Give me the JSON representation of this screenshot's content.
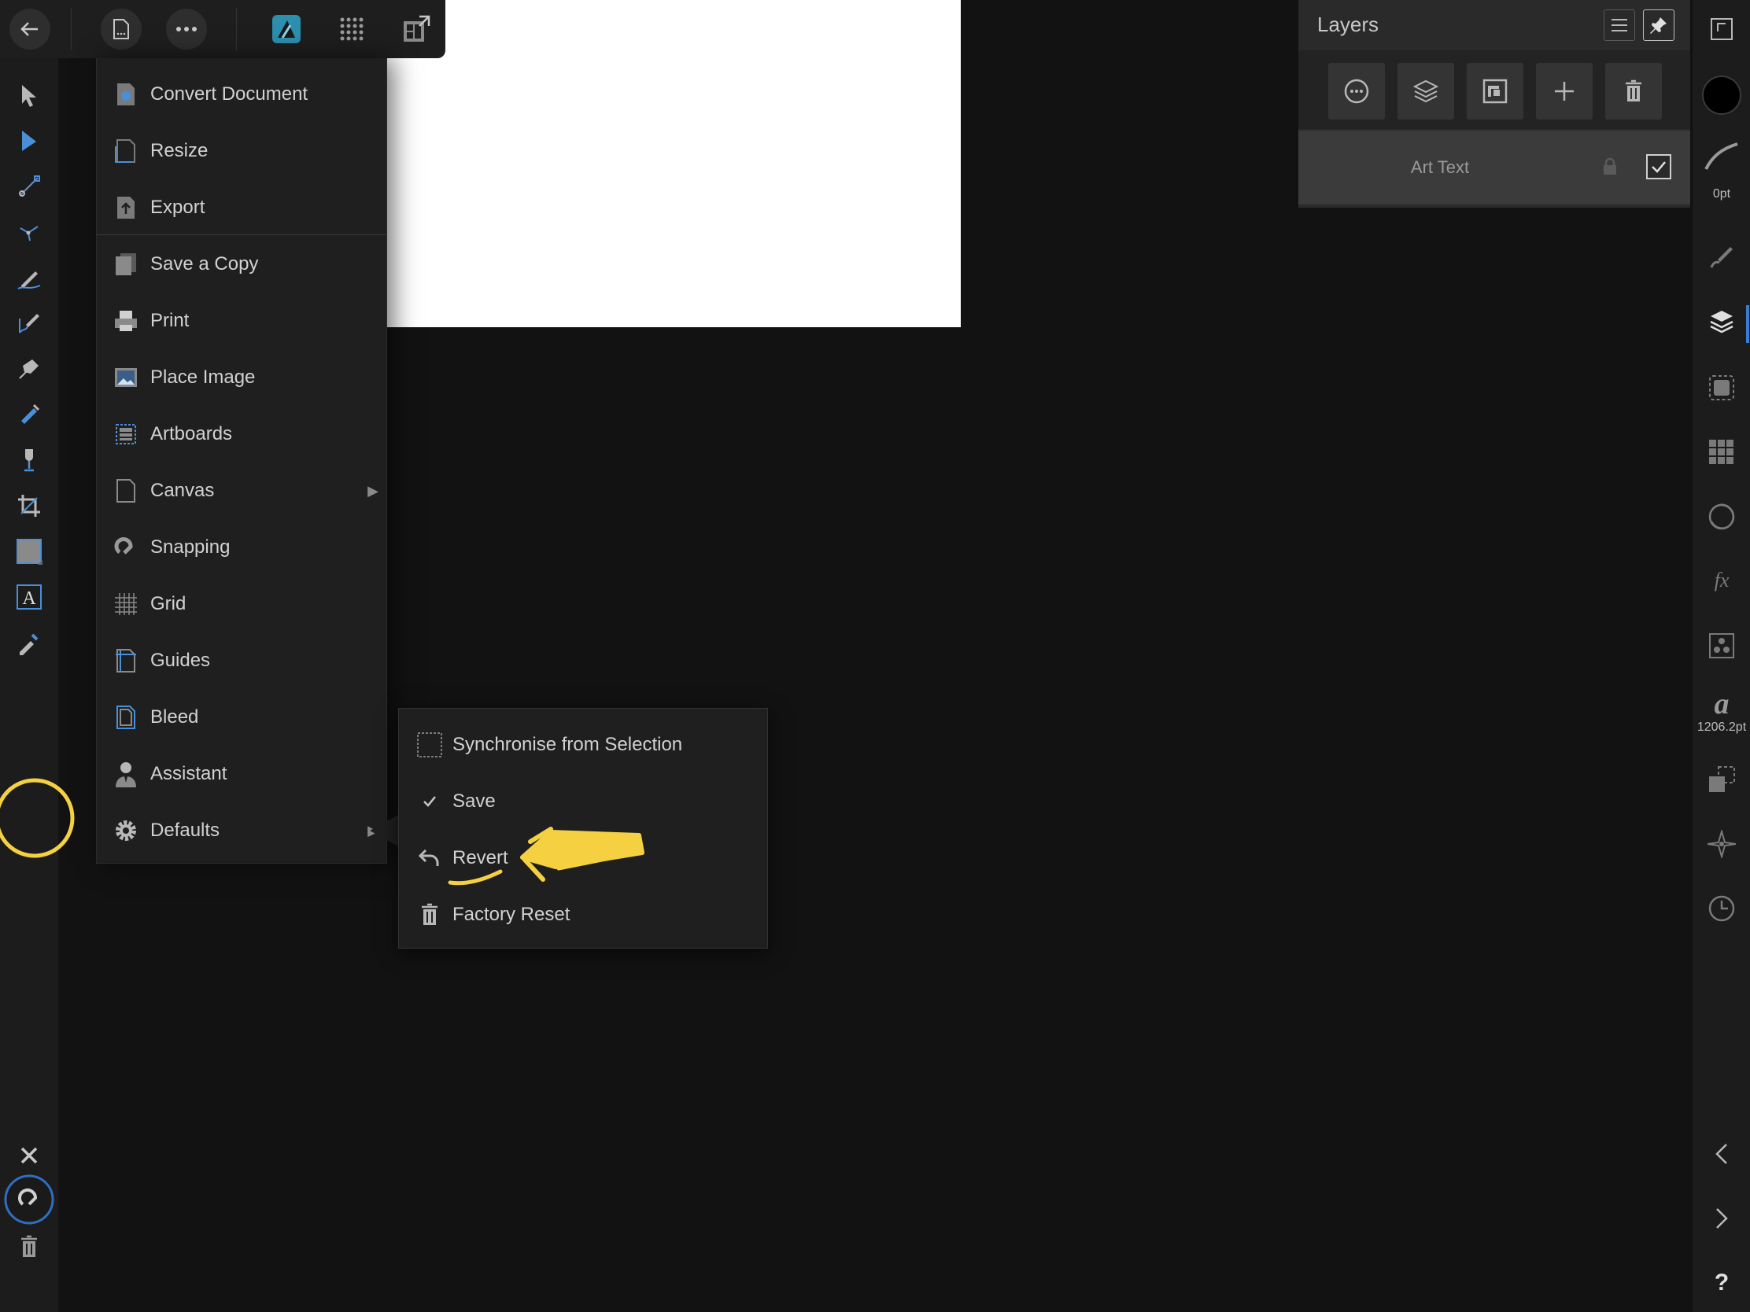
{
  "document_menu": {
    "items": [
      {
        "label": "Convert Document",
        "icon": "convert-document-icon"
      },
      {
        "label": "Resize",
        "icon": "resize-icon"
      },
      {
        "label": "Export",
        "icon": "export-icon"
      },
      {
        "label": "Save a Copy",
        "icon": "save-copy-icon"
      },
      {
        "label": "Print",
        "icon": "print-icon"
      },
      {
        "label": "Place Image",
        "icon": "place-image-icon"
      },
      {
        "label": "Artboards",
        "icon": "artboards-icon"
      },
      {
        "label": "Canvas",
        "icon": "canvas-icon",
        "submenu": true
      },
      {
        "label": "Snapping",
        "icon": "snapping-icon"
      },
      {
        "label": "Grid",
        "icon": "grid-icon"
      },
      {
        "label": "Guides",
        "icon": "guides-icon"
      },
      {
        "label": "Bleed",
        "icon": "bleed-icon"
      },
      {
        "label": "Assistant",
        "icon": "assistant-icon"
      },
      {
        "label": "Defaults",
        "icon": "gear-icon",
        "submenu": true
      }
    ]
  },
  "defaults_menu": {
    "items": [
      {
        "label": "Synchronise from Selection",
        "icon": "selection-icon"
      },
      {
        "label": "Save",
        "icon": "checkmark-icon"
      },
      {
        "label": "Revert",
        "icon": "revert-icon"
      },
      {
        "label": "Factory Reset",
        "icon": "trash-icon"
      }
    ]
  },
  "layers_panel": {
    "title": "Layers",
    "layer": {
      "name": "Art Text",
      "visible": true,
      "locked": false
    }
  },
  "right_bar": {
    "stroke_width": "0pt",
    "font_size": "1206.2pt",
    "help": "?"
  },
  "colors": {
    "accent": "#3a7bd5",
    "annotation": "#f5d142",
    "fill_swatch": "#000000"
  }
}
